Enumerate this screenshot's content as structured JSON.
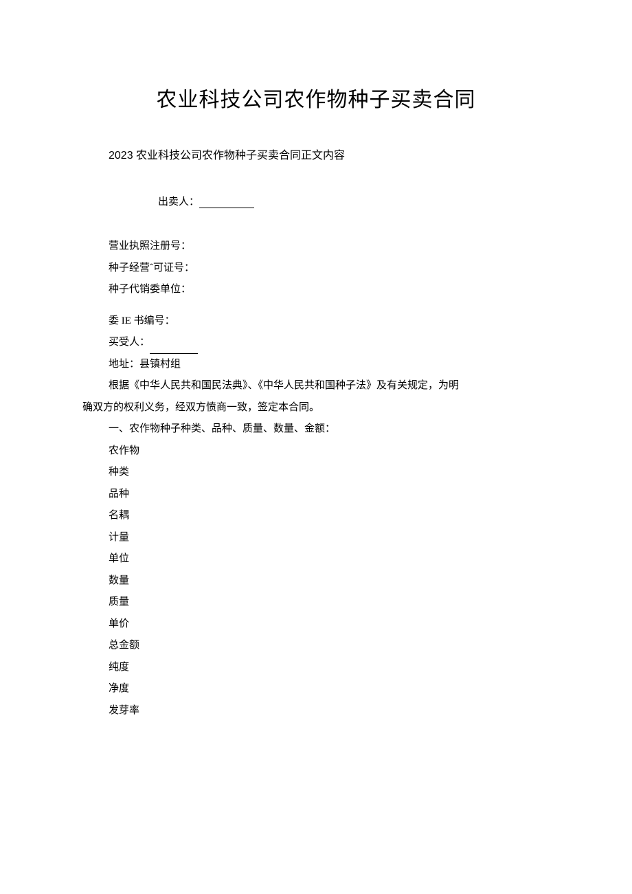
{
  "title": "农业科技公司农作物种子买卖合同",
  "subtitle": "2023 农业科技公司农作物种子买卖合同正文内容",
  "seller": {
    "label": "出卖人：",
    "value": ""
  },
  "fields": {
    "business_license": "营业执照注册号：",
    "seed_license": "种子经营ˆ可证号：",
    "consignment_unit": "种子代销委单位：",
    "commission_no": "委 IE 书编号：",
    "buyer_label": "买受人：",
    "buyer_value": "",
    "address": "地址：县镇村组"
  },
  "preamble_line1": "根据《中华人民共和国民法典》、《中华人民共和国种子法》及有关规定，为明",
  "preamble_line2": "确双方的权利义务，经双方愤商一致，签定本合同。",
  "section1_heading": "一、农作物种子种类、品种、质量、数量、金额：",
  "list": [
    "农作物",
    "种类",
    "品种",
    "名耦",
    "计量",
    "单位",
    "数量",
    "质量",
    "单价",
    "总金额",
    "纯度",
    "净度",
    "发芽率"
  ]
}
